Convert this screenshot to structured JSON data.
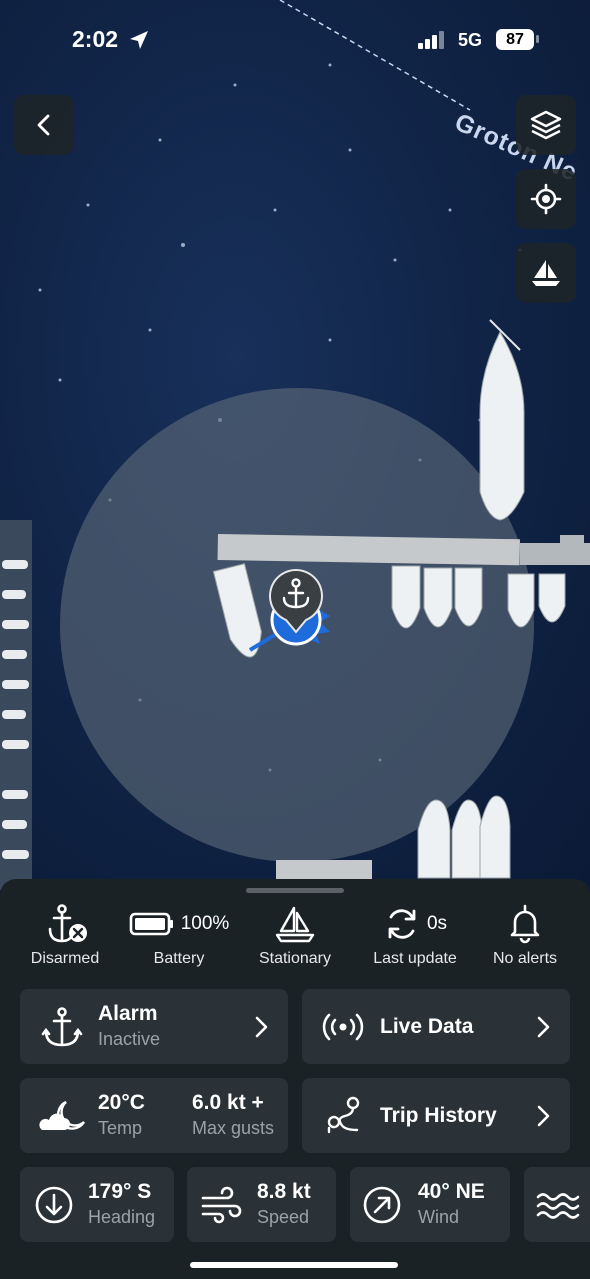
{
  "status_bar": {
    "time": "2:02",
    "network": "5G",
    "battery": "87"
  },
  "map": {
    "label": "Groton Ne",
    "buttons": [
      "back",
      "layers",
      "locate",
      "boat"
    ]
  },
  "stats": [
    {
      "icon": "anchor-disarmed-icon",
      "label": "Disarmed",
      "value": ""
    },
    {
      "icon": "battery-icon",
      "label": "Battery",
      "value": "100%"
    },
    {
      "icon": "sailboat-icon",
      "label": "Stationary",
      "value": ""
    },
    {
      "icon": "refresh-icon",
      "label": "Last update",
      "value": "0s"
    },
    {
      "icon": "bell-icon",
      "label": "No alerts",
      "value": ""
    }
  ],
  "alarm": {
    "title": "Alarm",
    "subtitle": "Inactive"
  },
  "live_data": {
    "title": "Live Data"
  },
  "weather": {
    "temp": "20°C",
    "temp_label": "Temp",
    "gusts": "6.0 kt +",
    "gusts_label": "Max gusts"
  },
  "trip_history": {
    "title": "Trip History"
  },
  "nav": [
    {
      "value": "179° S",
      "label": "Heading"
    },
    {
      "value": "8.8 kt",
      "label": "Speed"
    },
    {
      "value": "40° NE",
      "label": "Wind"
    }
  ],
  "colors": {
    "accent": "#1e6bdb",
    "sheet": "#1b2226",
    "card": "#2a3237"
  }
}
